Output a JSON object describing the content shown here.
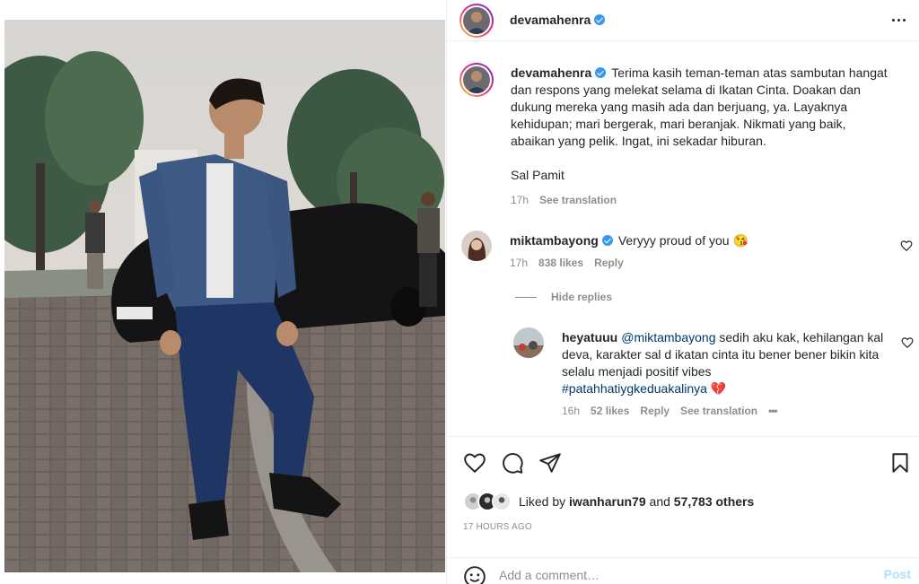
{
  "post": {
    "author": "devamahenra",
    "verified": true
  },
  "caption": {
    "username": "devamahenra",
    "text": "Terima kasih teman-teman atas sambutan hangat dan respons yang melekat selama di Ikatan Cinta. Doakan dan dukung mereka yang masih ada dan berjuang, ya. Layaknya kehidupan; mari bergerak, mari beranjak. Nikmati yang baik, abaikan yang pelik. Ingat, ini sekadar hiburan.",
    "signoff": "Sal Pamit",
    "time": "17h",
    "see_translation": "See translation"
  },
  "comments": [
    {
      "username": "miktambayong",
      "verified": true,
      "text": "Veryyy proud of you 😘",
      "time": "17h",
      "likes": "838 likes",
      "reply": "Reply"
    }
  ],
  "hide_replies": "Hide replies",
  "reply": {
    "username": "heyatuuu",
    "mention": "@miktambayong",
    "text": " sedih aku kak, kehilangan kal deva, karakter sal d ikatan cinta itu bener bener bikin kita selalu menjadi positif vibes",
    "hashtag": "#patahhatiygkeduakalinya",
    "emoji": "💔",
    "time": "16h",
    "likes": "52 likes",
    "reply": "Reply",
    "see_translation": "See translation",
    "more": "•••"
  },
  "likes": {
    "prefix": "Liked by",
    "user": "iwanharun79",
    "and": "and",
    "others": "57,783 others"
  },
  "timestamp": "17 HOURS AGO",
  "add_comment": {
    "placeholder": "Add a comment…",
    "post_label": "Post"
  },
  "colors": {
    "link": "#00376b",
    "muted": "#8e8e8e",
    "verified": "#3897f0",
    "post_disabled": "#b2dffc"
  },
  "icons": {
    "like": "heart-icon",
    "comment": "comment-icon",
    "share": "paper-plane-icon",
    "save": "bookmark-icon",
    "emoji": "smiley-icon",
    "more": "more-horizontal-icon"
  }
}
